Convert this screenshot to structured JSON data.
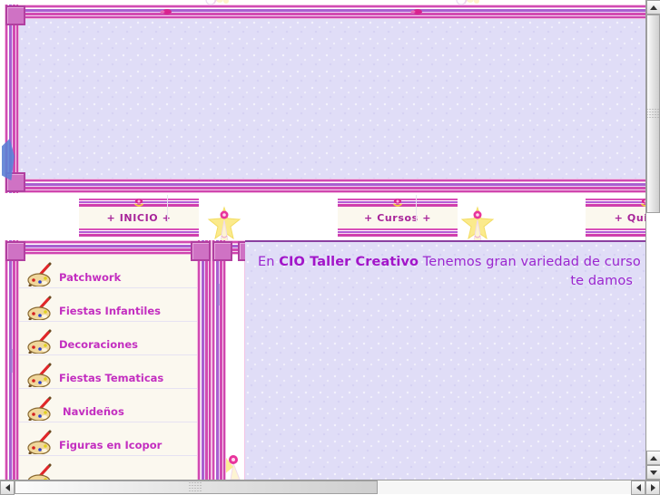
{
  "site": {
    "name": "CIO Taller Creativo",
    "colors": {
      "accent_pink": "#d24bb2",
      "accent_magenta": "#cf45ae",
      "accent_purple": "#a95fd0",
      "banner_fill": "#e0ddf7",
      "panel_cream": "#fbf8ef",
      "link_text": "#c32ec0",
      "nav_text": "#a8259a",
      "content_text": "#9b26cf"
    }
  },
  "nav": {
    "items": [
      {
        "label": "+ INICIO +",
        "icon": "rosette-icon"
      },
      {
        "label": "+ Cursos +",
        "icon": "rosette-icon"
      },
      {
        "label": "+ Quienes",
        "icon": "rosette-icon"
      }
    ]
  },
  "sidebar": {
    "items": [
      {
        "label": "Patchwork",
        "icon": "palette-icon"
      },
      {
        "label": "Fiestas Infantiles",
        "icon": "palette-icon"
      },
      {
        "label": "Decoraciones",
        "icon": "palette-icon"
      },
      {
        "label": "Fiestas Tematicas",
        "icon": "palette-icon"
      },
      {
        "label": "Navideños",
        "icon": "palette-icon"
      },
      {
        "label": "Figuras en Icopor",
        "icon": "palette-icon"
      },
      {
        "label": "",
        "icon": "palette-icon"
      }
    ]
  },
  "content": {
    "line1_prefix": "En ",
    "line1_strong": "CIO Taller Creativo",
    "line1_suffix": " Tenemos gran variedad de curso",
    "line2": "te damos"
  },
  "scrollbars": {
    "vertical": {
      "up_arrow": "▲",
      "down_arrow": "▼"
    },
    "horizontal": {
      "left_arrow": "◀",
      "right_arrow": "▶"
    }
  }
}
